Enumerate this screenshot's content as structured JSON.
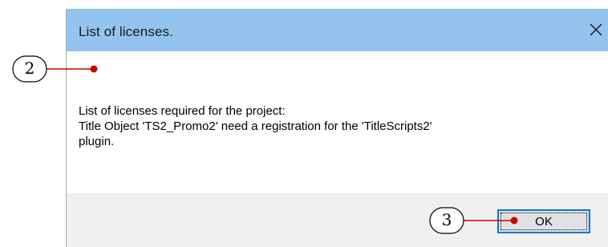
{
  "dialog": {
    "title": "List of licenses.",
    "close_icon": "close-icon",
    "message_lines": [
      "List of licenses required for the project:",
      "Title Object 'TS2_Promo2' need a registration for the 'TitleScripts2'",
      "plugin."
    ],
    "ok_label": "OK"
  },
  "callouts": [
    {
      "number": "2"
    },
    {
      "number": "3"
    }
  ],
  "colors": {
    "titlebar": "#92c4ee",
    "footer": "#f0f0f0",
    "button_border": "#0078d7",
    "callout_marker": "#cc0000"
  }
}
